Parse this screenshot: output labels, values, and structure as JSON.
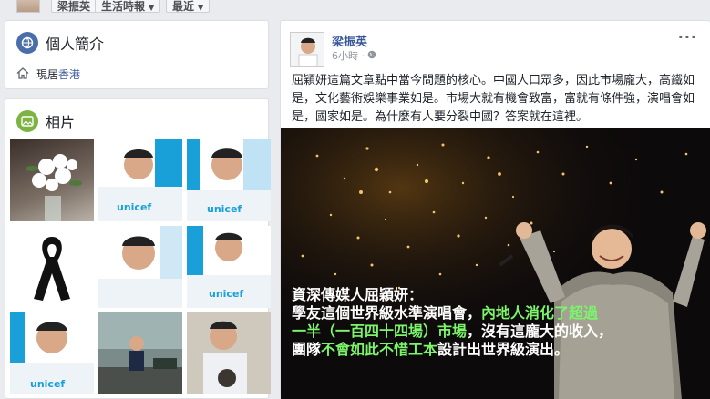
{
  "topbar": {
    "name_button": "梁振英",
    "timeline_button": "生活時報",
    "recent_button": "最近"
  },
  "intro": {
    "title": "個人簡介",
    "lives_prefix": "現居",
    "lives_city": "香港"
  },
  "photos": {
    "title": "相片"
  },
  "post": {
    "author": "梁振英",
    "time": "6小時 ·",
    "more": "···",
    "text": "屈穎妍這篇文章點中當今問題的核心。中國人口眾多，因此市場龐大，高鐵如是，文化藝術娛樂事業如是。市場大就有機會致富，富就有條件強，演唱會如是，國家如是。為什麼有人要分裂中國？答案就在這裡。",
    "image_caption": {
      "line1": "資深傳媒人屈穎妍：",
      "line2a": "學友這個世界級水準演唱會，",
      "line2b": "內地人消化了超過",
      "line3a": "一半（一百四十四場）市場",
      "line3b": "，沒有這龐大的收入，",
      "line4a": "團隊",
      "line4b": "不會如此不惜工本",
      "line4c": "設計出世界級演出。"
    }
  },
  "colors": {
    "link": "#385898",
    "highlight": "#7cf56a",
    "page_bg": "#e9ebee"
  }
}
